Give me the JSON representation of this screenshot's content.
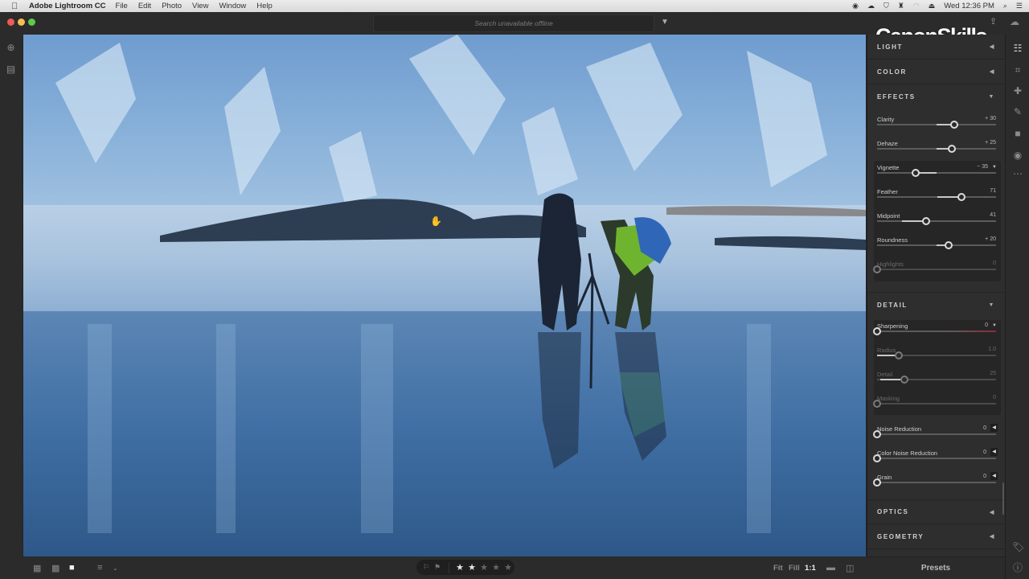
{
  "menubar": {
    "apple": "",
    "app_name": "Adobe Lightroom CC",
    "items": [
      "File",
      "Edit",
      "Photo",
      "View",
      "Window",
      "Help"
    ],
    "clock": "Wed 12:36 PM"
  },
  "titlebar": {
    "search_placeholder": "Search unavailable offline"
  },
  "watermark": "CanonSkills",
  "panel": {
    "sections": {
      "light": "LIGHT",
      "color": "COLOR",
      "effects": "EFFECTS",
      "detail": "DETAIL",
      "optics": "OPTICS",
      "geometry": "GEOMETRY"
    },
    "effects_sliders": [
      {
        "label": "Clarity",
        "value": "+ 30",
        "pos": 0.65,
        "bipolar": true
      },
      {
        "label": "Dehaze",
        "value": "+ 25",
        "pos": 0.625,
        "bipolar": true
      },
      {
        "label": "Vignette",
        "value": "− 35",
        "pos": 0.325,
        "bipolar": true
      },
      {
        "label": "Feather",
        "value": "71",
        "pos": 0.71,
        "bipolar": false
      },
      {
        "label": "Midpoint",
        "value": "41",
        "pos": 0.41,
        "bipolar": false
      },
      {
        "label": "Roundness",
        "value": "+ 20",
        "pos": 0.6,
        "bipolar": true
      },
      {
        "label": "Highlights",
        "value": "0",
        "pos": 0.0,
        "bipolar": false
      }
    ],
    "detail_sliders": [
      {
        "label": "Sharpening",
        "value": "0",
        "pos": 0.0
      },
      {
        "label": "Radius",
        "value": "1.0",
        "pos": 0.18
      },
      {
        "label": "Detail",
        "value": "25",
        "pos": 0.23
      },
      {
        "label": "Masking",
        "value": "0",
        "pos": 0.0
      },
      {
        "label": "Noise Reduction",
        "value": "0",
        "pos": 0.0
      },
      {
        "label": "Color Noise Reduction",
        "value": "0",
        "pos": 0.0
      },
      {
        "label": "Grain",
        "value": "0",
        "pos": 0.0
      }
    ],
    "presets_label": "Presets"
  },
  "bottombar": {
    "rating": 2,
    "rating_max": 5,
    "zoom_options": [
      "Fit",
      "Fill",
      "1:1"
    ],
    "zoom_active": "1:1"
  }
}
